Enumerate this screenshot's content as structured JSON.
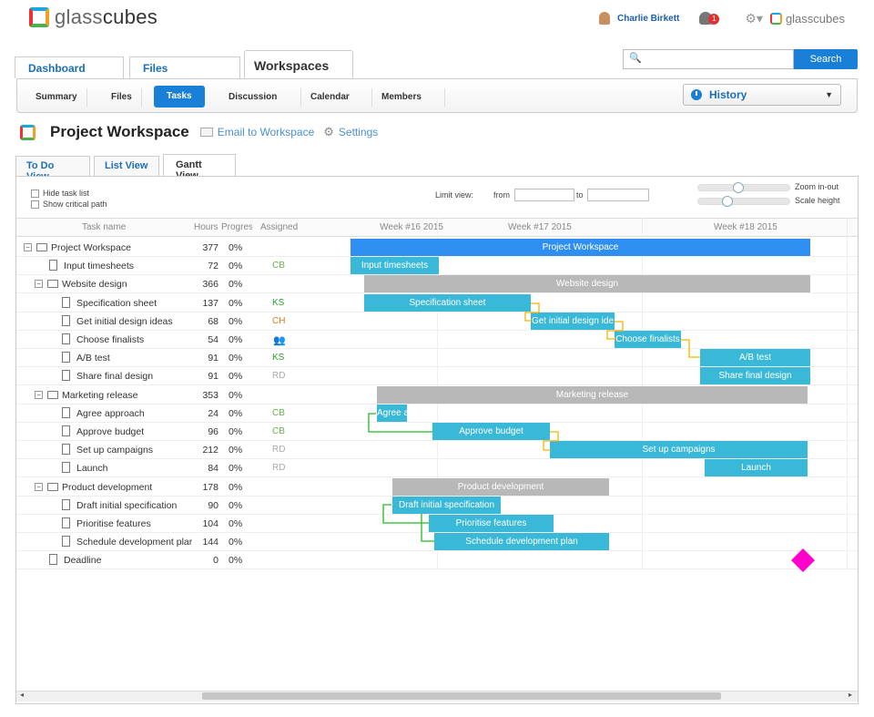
{
  "header": {
    "logo_text_light": "glass",
    "logo_text_bold": "cubes",
    "user_name": "Charlie Birkett",
    "notifications": "1",
    "brand_small": "glasscubes"
  },
  "main_tabs": {
    "dashboard": "Dashboard",
    "files": "Files",
    "workspaces": "Workspaces"
  },
  "search": {
    "placeholder": "",
    "button": "Search"
  },
  "subnav": {
    "summary": "Summary",
    "files": "Files",
    "tasks": "Tasks",
    "discussion": "Discussion",
    "calendar": "Calendar",
    "members": "Members"
  },
  "history": {
    "label": "History"
  },
  "workspace": {
    "title": "Project Workspace",
    "email_link": "Email to Workspace",
    "settings_link": "Settings"
  },
  "view_tabs": {
    "todo": "To Do View",
    "list": "List View",
    "gantt": "Gantt View"
  },
  "controls": {
    "hide_task_list": "Hide task list",
    "show_critical_path": "Show critical path",
    "limit_view": "Limit view:",
    "from": "from",
    "to": "to",
    "zoom": "Zoom in-out",
    "scale": "Scale height"
  },
  "grid": {
    "col_task": "Task name",
    "col_hours": "Hours",
    "col_progress": "Progres",
    "col_assigned": "Assigned",
    "weeks": [
      "Week #16 2015",
      "Week #17 2015",
      "Week #18 2015"
    ]
  },
  "tasks": [
    {
      "name": "Project Workspace",
      "hours": "377",
      "progress": "0%",
      "assigned": "",
      "color": "#333"
    },
    {
      "name": "Input timesheets",
      "hours": "72",
      "progress": "0%",
      "assigned": "CB",
      "color": "#6ab04c"
    },
    {
      "name": "Website design",
      "hours": "366",
      "progress": "0%",
      "assigned": "",
      "color": "#333"
    },
    {
      "name": "Specification sheet",
      "hours": "137",
      "progress": "0%",
      "assigned": "KS",
      "color": "#2e9b2e"
    },
    {
      "name": "Get initial design ideas",
      "hours": "68",
      "progress": "0%",
      "assigned": "CH",
      "color": "#e07b1a"
    },
    {
      "name": "Choose finalists",
      "hours": "54",
      "progress": "0%",
      "assigned": "",
      "color": "#333"
    },
    {
      "name": "A/B test",
      "hours": "91",
      "progress": "0%",
      "assigned": "KS",
      "color": "#2e9b2e"
    },
    {
      "name": "Share final design",
      "hours": "91",
      "progress": "0%",
      "assigned": "RD",
      "color": "#aaa"
    },
    {
      "name": "Marketing release",
      "hours": "353",
      "progress": "0%",
      "assigned": "",
      "color": "#333"
    },
    {
      "name": "Agree approach",
      "hours": "24",
      "progress": "0%",
      "assigned": "CB",
      "color": "#6ab04c"
    },
    {
      "name": "Approve budget",
      "hours": "96",
      "progress": "0%",
      "assigned": "CB",
      "color": "#6ab04c"
    },
    {
      "name": "Set up campaigns",
      "hours": "212",
      "progress": "0%",
      "assigned": "RD",
      "color": "#aaa"
    },
    {
      "name": "Launch",
      "hours": "84",
      "progress": "0%",
      "assigned": "RD",
      "color": "#aaa"
    },
    {
      "name": "Product development",
      "hours": "178",
      "progress": "0%",
      "assigned": "",
      "color": "#333"
    },
    {
      "name": "Draft initial specification",
      "hours": "90",
      "progress": "0%",
      "assigned": "",
      "color": "#333"
    },
    {
      "name": "Prioritise features",
      "hours": "104",
      "progress": "0%",
      "assigned": "",
      "color": "#333"
    },
    {
      "name": "Schedule development plar",
      "hours": "144",
      "progress": "0%",
      "assigned": "",
      "color": "#333"
    },
    {
      "name": "Deadline",
      "hours": "0",
      "progress": "0%",
      "assigned": "",
      "color": "#333"
    }
  ],
  "bars": [
    {
      "label": "Project Workspace"
    },
    {
      "label": "Input timesheets"
    },
    {
      "label": "Website design"
    },
    {
      "label": "Specification sheet"
    },
    {
      "label": "Get initial design ide"
    },
    {
      "label": "Choose finalists"
    },
    {
      "label": "A/B test"
    },
    {
      "label": "Share final design"
    },
    {
      "label": "Marketing release"
    },
    {
      "label": "Agree a"
    },
    {
      "label": "Approve budget"
    },
    {
      "label": "Set up campaigns"
    },
    {
      "label": "Launch"
    },
    {
      "label": "Product development"
    },
    {
      "label": "Draft initial specification"
    },
    {
      "label": "Prioritise features"
    },
    {
      "label": "Schedule development plan"
    }
  ],
  "colors": {
    "accent": "#1a7fd6",
    "summary_bar": "#b8b8b8",
    "task_bar": "#3ab8d8",
    "root_bar": "#2f8ff0",
    "milestone": "#ff00cc",
    "dependency_yellow": "#f5b400",
    "dependency_green": "#22bb22"
  }
}
